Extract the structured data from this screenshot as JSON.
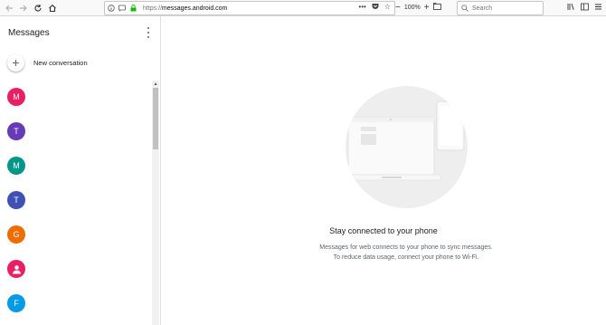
{
  "browser": {
    "url_protocol": "https://",
    "url_host": "messages.android.com",
    "zoom": "100%",
    "search_placeholder": "Search"
  },
  "sidebar": {
    "title": "Messages",
    "new_conversation": "New conversation",
    "conversations": [
      {
        "initial": "M",
        "color": "#e91e63"
      },
      {
        "initial": "T",
        "color": "#673ab7"
      },
      {
        "initial": "M",
        "color": "#009688"
      },
      {
        "initial": "T",
        "color": "#3f51b5"
      },
      {
        "initial": "G",
        "color": "#ef6c00"
      },
      {
        "initial": "",
        "color": "#e91e63",
        "icon": "person-icon"
      },
      {
        "initial": "F",
        "color": "#039be5"
      }
    ]
  },
  "main": {
    "title": "Stay connected to your phone",
    "subtitle_line1": "Messages for web connects to your phone to sync messages.",
    "subtitle_line2": "To reduce data usage, connect your phone to Wi-Fi."
  }
}
